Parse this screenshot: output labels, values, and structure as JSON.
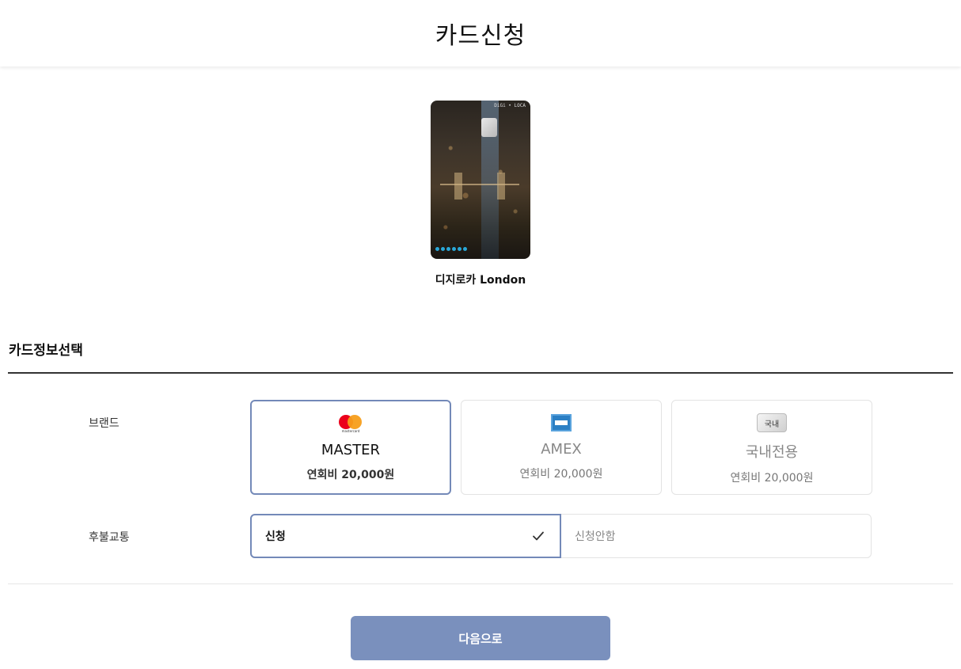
{
  "header": {
    "title": "카드신청"
  },
  "card": {
    "name": "디지로카 London",
    "card_mark": "DiGi • LOCA"
  },
  "section": {
    "title": "카드정보선택"
  },
  "brand": {
    "label": "브랜드",
    "options": [
      {
        "name": "MASTER",
        "fee": "연회비 20,000원",
        "logo_text": "mastercard",
        "selected": true
      },
      {
        "name": "AMEX",
        "fee": "연회비 20,000원",
        "selected": false
      },
      {
        "name": "국내전용",
        "fee": "연회비 20,000원",
        "logo_text": "국내",
        "selected": false
      }
    ]
  },
  "transit": {
    "label": "후불교통",
    "options": [
      {
        "label": "신청",
        "selected": true
      },
      {
        "label": "신청안함",
        "selected": false
      }
    ]
  },
  "next_button": {
    "label": "다음으로"
  },
  "colors": {
    "accent": "#7389b8",
    "button": "#7a90bd"
  }
}
